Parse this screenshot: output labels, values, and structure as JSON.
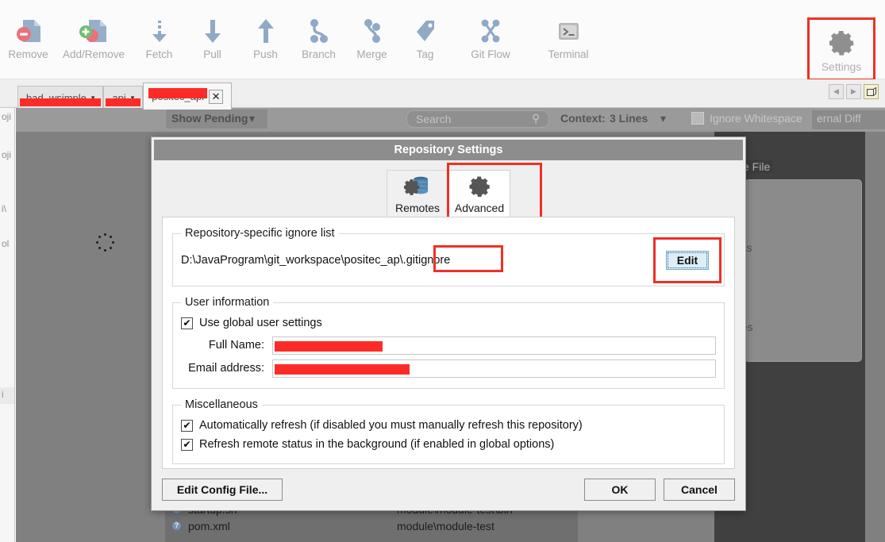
{
  "toolbar": {
    "items": [
      {
        "label": "Remove",
        "icon": "remove-file-icon"
      },
      {
        "label": "Add/Remove",
        "icon": "add-remove-file-icon"
      },
      {
        "label": "Fetch",
        "icon": "fetch-icon"
      },
      {
        "label": "Pull",
        "icon": "pull-icon"
      },
      {
        "label": "Push",
        "icon": "push-icon"
      },
      {
        "label": "Branch",
        "icon": "branch-icon"
      },
      {
        "label": "Merge",
        "icon": "merge-icon"
      },
      {
        "label": "Tag",
        "icon": "tag-icon"
      },
      {
        "label": "Git Flow",
        "icon": "git-flow-icon"
      },
      {
        "label": "Terminal",
        "icon": "terminal-icon"
      }
    ],
    "settings": {
      "label": "Settings",
      "icon": "gear-icon",
      "highlight_color": "#ee3124"
    }
  },
  "tabbar": {
    "tabs": [
      {
        "label": "bad_wsimple",
        "redacted": true,
        "active": false,
        "caret": "▾"
      },
      {
        "label": "api",
        "redacted": true,
        "active": false,
        "caret": "▾"
      },
      {
        "label": "positec_api",
        "redacted": true,
        "active": true,
        "close": "✕"
      }
    ],
    "nav": {
      "back": "◀",
      "forward": "▶",
      "window_icon": "new-window-icon"
    }
  },
  "background": {
    "left_rail_labels": [
      "oji",
      "oji",
      "i\\",
      "ol",
      "i"
    ],
    "show_pending": "Show Pending",
    "show_pending_caret": "▾",
    "search_placeholder": "Search",
    "context_label": "Context:",
    "context_value": "3 Lines",
    "context_caret": "▾",
    "ignore_whitespace": "Ignore Whitespace",
    "external_diff": "ernal Diff",
    "partial_file": "e File",
    "partial_ers": "ers",
    "partial_nes": "nes",
    "file_list": [
      {
        "name": "startup.sh",
        "path": "module\\module-test\\bin",
        "icon": "unknown-file-icon"
      },
      {
        "name": "pom.xml",
        "path": "module\\module-test",
        "icon": "unknown-file-icon"
      }
    ]
  },
  "dialog": {
    "title": "Repository Settings",
    "tabs": [
      {
        "label": "Remotes",
        "icon": "remotes-database-icon",
        "selected": false
      },
      {
        "label": "Advanced",
        "icon": "gear-icon",
        "selected": true
      }
    ],
    "advanced_highlight_color": "#ee3124",
    "ignore_section": {
      "legend": "Repository-specific ignore list",
      "path_prefix": "D:\\JavaProgram\\git_workspace\\positec_ap",
      "path_suffix": "\\.gitignore",
      "edit_button": "Edit",
      "highlight_color": "#ee3124"
    },
    "user_section": {
      "legend": "User information",
      "use_global_label": "Use global user settings",
      "use_global_checked": "✔",
      "full_name_label": "Full Name:",
      "full_name_value": "",
      "email_label": "Email address:",
      "email_value": ""
    },
    "misc_section": {
      "legend": "Miscellaneous",
      "auto_refresh_label": "Automatically refresh (if disabled you must manually refresh this repository)",
      "auto_refresh_checked": "✔",
      "remote_status_label": "Refresh remote status in the background (if enabled in global options)",
      "remote_status_checked": "✔"
    },
    "footer": {
      "edit_config": "Edit Config File...",
      "ok": "OK",
      "cancel": "Cancel"
    }
  }
}
